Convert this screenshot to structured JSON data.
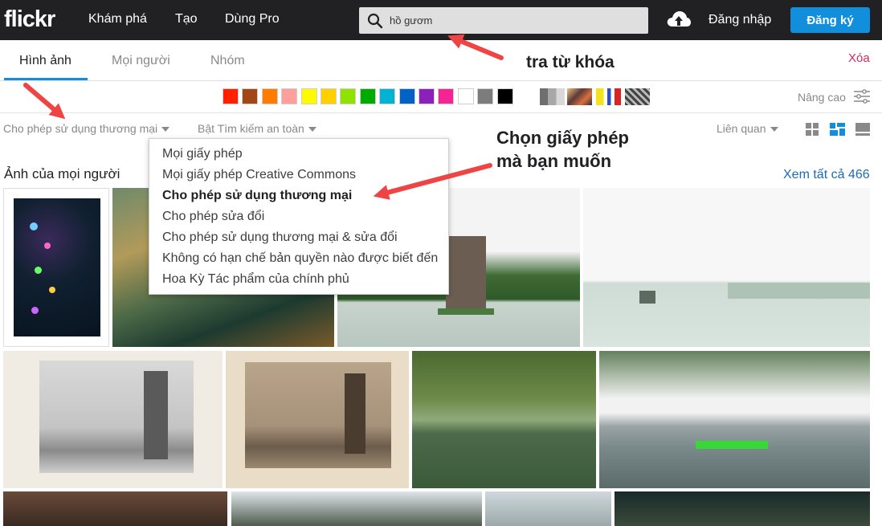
{
  "header": {
    "logo": "flickr",
    "nav": [
      "Khám phá",
      "Tạo",
      "Dùng Pro"
    ],
    "search_value": "hồ gươm",
    "login_label": "Đăng nhập",
    "signup_label": "Đăng ký"
  },
  "tabs": {
    "items": [
      "Hình ảnh",
      "Mọi người",
      "Nhóm"
    ],
    "active": "Hình ảnh",
    "clear_label": "Xóa"
  },
  "colors": {
    "swatches": [
      "#ff2000",
      "#a24615",
      "#ff7c00",
      "#ff9f9c",
      "#fffa00",
      "#ffcf00",
      "#90e200",
      "#00ab00",
      "#00b2d4",
      "#0062c6",
      "#8c20ba",
      "#f52394",
      "#ffffff",
      "#7c7c7c",
      "#000000"
    ],
    "advanced_label": "Nâng cao"
  },
  "filters": {
    "license_label": "Cho phép sử dụng thương mại",
    "safesearch_label": "Bật Tìm kiếm an toàn",
    "sort_label": "Liên quan"
  },
  "license_menu": {
    "items": [
      "Mọi giấy phép",
      "Mọi giấy phép Creative Commons",
      "Cho phép sử dụng thương mại",
      "Cho phép sửa đổi",
      "Cho phép sử dụng thương mại & sửa đổi",
      "Không có hạn chế bản quyền nào được biết đến",
      "Hoa Kỳ Tác phẩm của chính phủ"
    ],
    "selected_index": 2
  },
  "results": {
    "section_title": "Ảnh của mọi người",
    "see_all_label": "Xem tất cả 466"
  },
  "annotations": {
    "search_note": "tra từ khóa",
    "license_note_line1": "Chọn giấy phép",
    "license_note_line2": "mà bạn muốn",
    "arrow_color": "#ee4444"
  }
}
